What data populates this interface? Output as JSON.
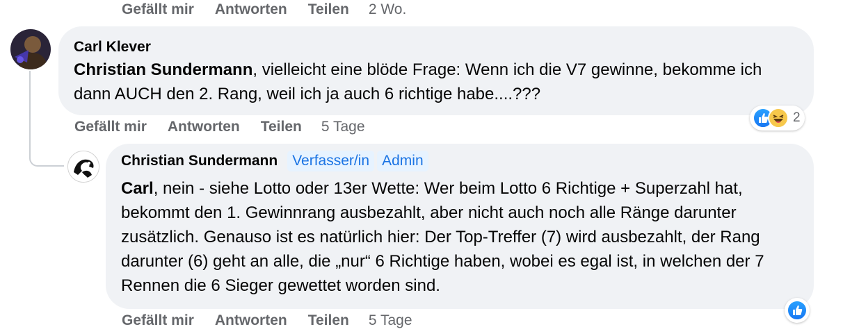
{
  "top_actions": {
    "like": "Gefällt mir",
    "reply": "Antworten",
    "share": "Teilen",
    "time": "2 Wo."
  },
  "comment1": {
    "author": "Carl Klever",
    "mention": "Christian Sundermann",
    "text": ", vielleicht eine blöde Frage: Wenn ich die V7 gewinne, bekomme ich dann AUCH den 2. Rang, weil ich ja auch 6 richtige habe....???",
    "reaction_count": "2",
    "reactions": [
      "like-icon",
      "haha-icon"
    ],
    "actions": {
      "like": "Gefällt mir",
      "reply": "Antworten",
      "share": "Teilen",
      "time": "5 Tage"
    }
  },
  "reply1": {
    "author": "Christian Sundermann",
    "badges": [
      "Verfasser/in",
      "Admin"
    ],
    "mention": "Carl",
    "text": ", nein - siehe Lotto oder 13er Wette: Wer beim Lotto 6 Richtige + Superzahl hat, bekommt den 1. Gewinnrang ausbezahlt, aber nicht auch noch alle Ränge darunter zusätzlich. Genauso ist es natürlich hier: Der Top-Treffer (7) wird ausbezahlt, der Rang darunter (6) geht an alle, die „nur“ 6 Richtige haben, wobei es egal ist, in welchen der 7 Rennen die 6 Sieger gewettet worden sind.",
    "reactions": [
      "like-icon"
    ],
    "actions": {
      "like": "Gefällt mir",
      "reply": "Antworten",
      "share": "Teilen",
      "time": "5 Tage"
    }
  },
  "colors": {
    "bubble": "#f0f2f5",
    "meta": "#65676b",
    "badge_bg": "#e7f3ff",
    "badge_text": "#1b74e4",
    "like_blue": "#1877f2"
  }
}
